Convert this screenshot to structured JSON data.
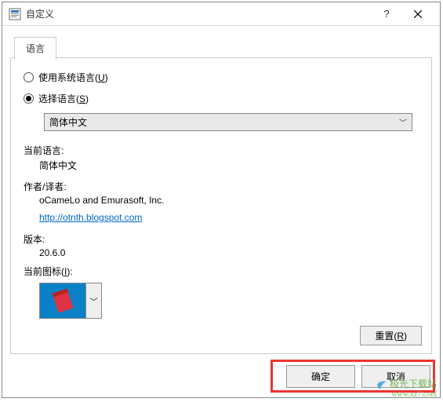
{
  "window": {
    "title": "自定义",
    "help": "?",
    "close": "×"
  },
  "tab": {
    "language": "语言"
  },
  "radio": {
    "use_system": "使用系统语言(",
    "use_system_key": "U",
    "use_system_suffix": ")",
    "select_lang": "选择语言(",
    "select_lang_key": "S",
    "select_lang_suffix": ")"
  },
  "select": {
    "value": "简体中文"
  },
  "labels": {
    "current_lang": "当前语言:",
    "author": "作者/译者:",
    "version": "版本:",
    "current_icon": "当前图标(",
    "current_icon_key": "I",
    "current_icon_suffix": "):"
  },
  "values": {
    "current_lang": "简体中文",
    "author": "oCameLo and Emurasoft, Inc.",
    "link": "http://otnth.blogspot.com",
    "version": "20.6.0"
  },
  "buttons": {
    "reset": "重置(",
    "reset_key": "R",
    "reset_suffix": ")",
    "ok": "确定",
    "cancel": "取消"
  },
  "watermark": {
    "line1": "极光下载站",
    "line2": "www.xz7.com"
  }
}
